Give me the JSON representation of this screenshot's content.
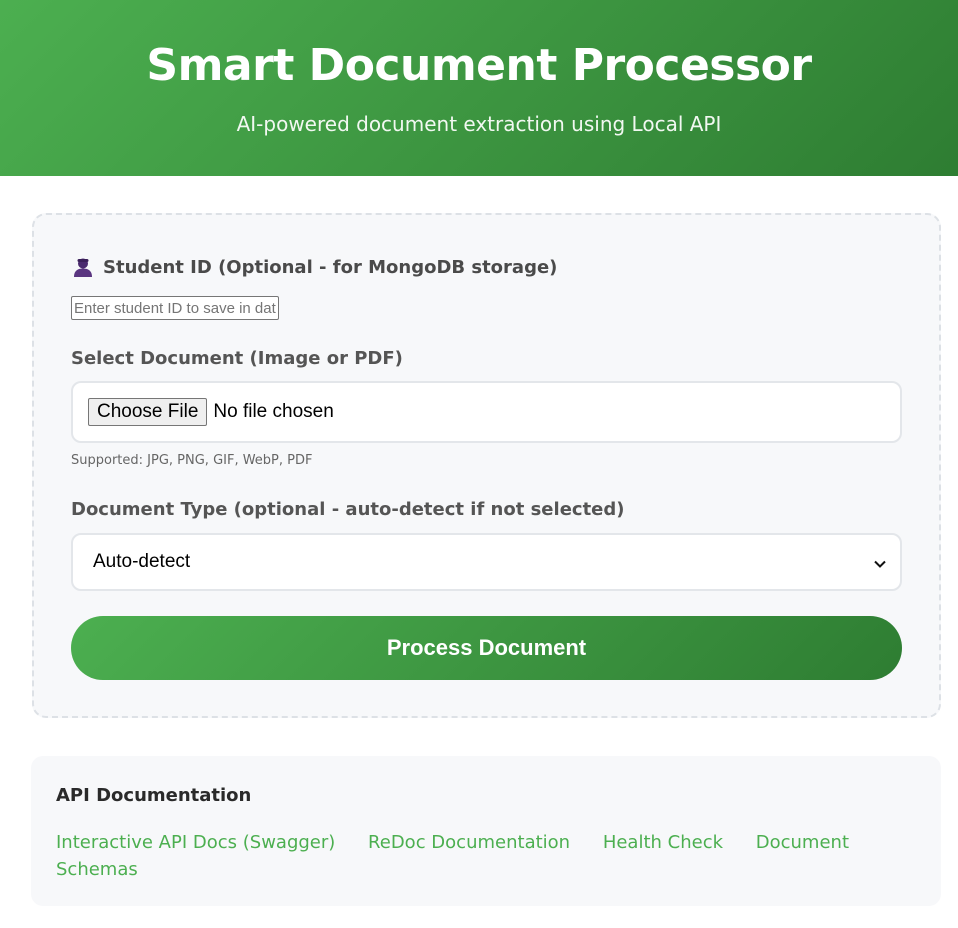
{
  "header": {
    "title": "Smart Document Processor",
    "subtitle": "AI-powered document extraction using Local API"
  },
  "upload_form": {
    "student_id": {
      "icon": "person-icon",
      "label": "Student ID (Optional - for MongoDB storage)",
      "placeholder": "Enter student ID to save in database",
      "value": ""
    },
    "document": {
      "label": "Select Document (Image or PDF)",
      "button_label": "Choose File",
      "status": "No file chosen",
      "hint": "Supported: JPG, PNG, GIF, WebP, PDF"
    },
    "document_type": {
      "label": "Document Type (optional - auto-detect if not selected)",
      "selected": "Auto-detect"
    },
    "submit_label": "Process Document"
  },
  "api_docs": {
    "title": "API Documentation",
    "links": [
      {
        "label": "Interactive API Docs (Swagger)"
      },
      {
        "label": "ReDoc Documentation"
      },
      {
        "label": "Health Check"
      },
      {
        "label": "Document Schemas"
      }
    ]
  },
  "colors": {
    "accent": "#4caf50",
    "accent_dark": "#2e7d32",
    "card_bg": "#f7f8fa"
  }
}
